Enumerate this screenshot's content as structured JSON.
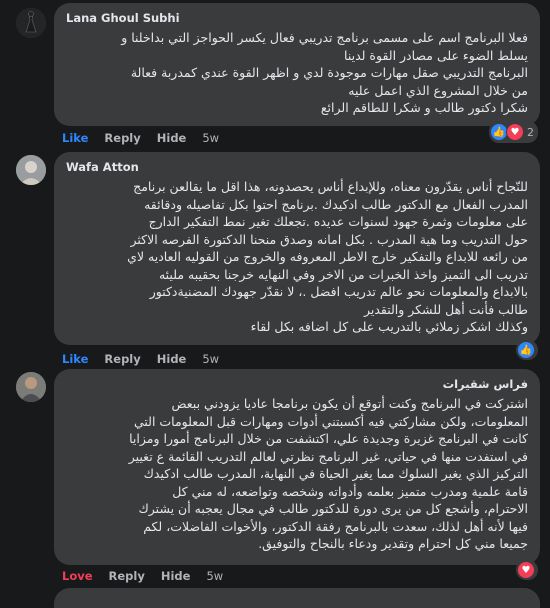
{
  "comments": [
    {
      "author": "Lana Ghoul Subhi",
      "text": "فعلا البرنامج اسم على مسمى برنامج تدريبي فعال يكسر الحواجز التي بداخلنا و\nيسلط الضوء على مصادر القوة لدينا\nالبرنامج التدريبي صقل مهارات موجودة لدي و اظهر القوة عندي كمدربة فعالة\nمن خلال المشروع الذي اعمل عليه\nشكرا دكتور طالب و شكرا للطاقم الرائع",
      "like_label": "Like",
      "reply_label": "Reply",
      "hide_label": "Hide",
      "time": "5w",
      "reaction_count": "2",
      "reaction_icons": [
        "like-icon",
        "love-icon"
      ]
    },
    {
      "author": "Wafa Atton",
      "text": "للنّجاح أناس يقدّرون معناه، وللإبداع أناس يحصدونه، هذا اقل ما يقالعن برنامج\nالمدرب الفعال مع الدكتور طالب ادكيدك .برنامج احتوا بكل تفاصيله ودقائقه\nعلى معلومات وثمرة جهود لسنوات عديده .تجعلك تغير نمط التفكير الدارج\nحول التدريب وما هية المدرب . بكل امانه وصدق منحنا الدكتورة الفرصه الاكثر\nمن رائعه للابداع والتفكير خارج الاطر المعروفه والخروج من القوليه العاديه لاي\nتدريب الى التميز واخذ الخبرات من الاخر وفي النهايه خرجنا بحقيبه مليئه\nبالابداع والمعلومات نحو عالم تدريب افضل .، لا نقدّر جهودك المضنيةدكتور\nطالب فأنت أهل للشكر والتقدير\nوكذلك اشكر زملائي بالتدريب على كل اضافه بكل لقاء",
      "like_label": "Like",
      "reply_label": "Reply",
      "hide_label": "Hide",
      "time": "5w",
      "reaction_icons": [
        "like-icon"
      ]
    },
    {
      "author": "فراس شقيرات",
      "text": "اشتركت في البرنامج وكنت أتوقع أن يكون برنامجا عاديا يزودني ببعض\nالمعلومات، ولكن مشاركتي فيه أكسبتني أدوات ومهارات قبل المعلومات التي\nكانت في البرنامج غزيرة وجديدة علي، اكتشفت من خلال البرنامج أمورا ومزايا\nفي استفدت منها في حياتي، غير البرنامج نظرتي لعالم التدريب القائمة ع تغيير\nالتركيز الذي يغير السلوك مما يغير الحياة في النهاية، المدرب طالب ادكيدك\nقامة علمية ومدرب متميز بعلمه وأدواته وشخصه وتواضعه، له مني كل\nالاحترام، وأشجع كل من يرى دورة للدكتور طالب في مجال يعجبه أن يشترك\nفيها لأنه أهل لذلك، سعدت بالبرنامج رفقة الدكتور، والأخوات الفاضلات، لكم\nجميعا مني كل احترام وتقدير ودعاء بالنجاح والتوفيق.",
      "love_label": "Love",
      "reply_label": "Reply",
      "hide_label": "Hide",
      "time": "5w",
      "reaction_icons": [
        "love-icon"
      ]
    }
  ],
  "colors": {
    "background": "#18191a",
    "bubble": "#3a3b3c",
    "like_blue": "#2d88ff",
    "love_red": "#f33e58",
    "muted": "#b0b3b8"
  }
}
